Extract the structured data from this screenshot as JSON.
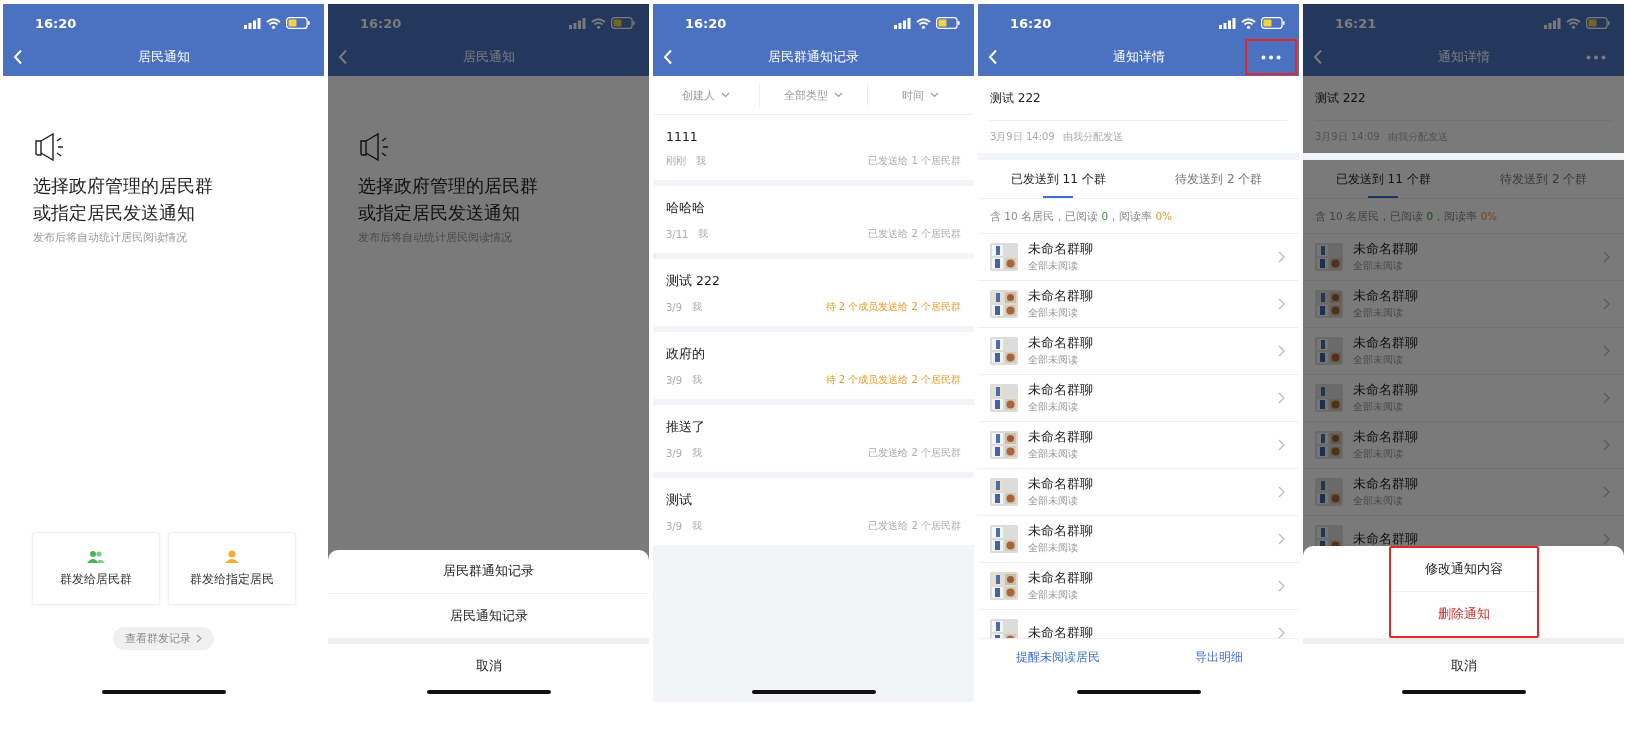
{
  "screens": [
    {
      "kind": "home",
      "dimmed": false,
      "time": "16:20",
      "title": "居民通知",
      "headline": "选择政府管理的居民群或指定居民发送通知",
      "subtitle": "发布后将自动统计居民阅读情况",
      "actions": [
        {
          "label": "群发给居民群",
          "kind": "group"
        },
        {
          "label": "群发给指定居民",
          "kind": "person"
        }
      ],
      "record_link": "查看群发记录"
    },
    {
      "kind": "home",
      "dimmed": true,
      "time": "16:20",
      "title": "居民通知",
      "headline": "选择政府管理的居民群或指定居民发送通知",
      "subtitle": "发布后将自动统计居民阅读情况",
      "sheet": {
        "highlighted": false,
        "options": [
          {
            "label": "居民群通知记录",
            "danger": false
          },
          {
            "label": "居民通知记录",
            "danger": false
          }
        ],
        "cancel": "取消"
      }
    },
    {
      "kind": "records",
      "dimmed": false,
      "time": "16:20",
      "title": "居民群通知记录",
      "filters": [
        "创建人",
        "全部类型",
        "时间"
      ],
      "records": [
        {
          "title": "1111",
          "date": "刚刚",
          "author": "我",
          "status": "已发送给 1 个居民群",
          "pending": false
        },
        {
          "title": "哈哈哈",
          "date": "3/11",
          "author": "我",
          "status": "已发送给 2 个居民群",
          "pending": false
        },
        {
          "title": "测试 222",
          "date": "3/9",
          "author": "我",
          "status": "待 2 个成员发送给 2 个居民群",
          "pending": true
        },
        {
          "title": "政府的",
          "date": "3/9",
          "author": "我",
          "status": "待 2 个成员发送给 2 个居民群",
          "pending": true
        },
        {
          "title": "推送了",
          "date": "3/9",
          "author": "我",
          "status": "已发送给 2 个居民群",
          "pending": false
        },
        {
          "title": "测试",
          "date": "3/9",
          "author": "我",
          "status": "已发送给 2 个居民群",
          "pending": false
        }
      ]
    },
    {
      "kind": "detail",
      "dimmed": false,
      "time": "16:20",
      "title": "通知详情",
      "more_highlighted": true,
      "notice": {
        "title": "测试 222",
        "date": "3月9日 14:09",
        "note": "由我分配发送"
      },
      "tabs": [
        {
          "label": "已发送到 11 个群",
          "selected": true
        },
        {
          "label": "待发送到 2 个群",
          "selected": false
        }
      ],
      "summary": [
        {
          "text": "含 10 名居民，已阅读 ",
          "kind": "plain"
        },
        {
          "text": "0",
          "kind": "read"
        },
        {
          "text": "，阅读率 ",
          "kind": "plain"
        },
        {
          "text": "0%",
          "kind": "rate"
        }
      ],
      "groups": [
        {
          "name": "未命名群聊",
          "status": "全部未阅读"
        },
        {
          "name": "未命名群聊",
          "status": "全部未阅读"
        },
        {
          "name": "未命名群聊",
          "status": "全部未阅读"
        },
        {
          "name": "未命名群聊",
          "status": "全部未阅读"
        },
        {
          "name": "未命名群聊",
          "status": "全部未阅读"
        },
        {
          "name": "未命名群聊",
          "status": "全部未阅读"
        },
        {
          "name": "未命名群聊",
          "status": "全部未阅读"
        },
        {
          "name": "未命名群聊",
          "status": "全部未阅读"
        },
        {
          "name": "未命名群聊"
        }
      ],
      "footer": [
        "提醒未阅读居民",
        "导出明细"
      ]
    },
    {
      "kind": "detail",
      "dimmed": true,
      "time": "16:21",
      "title": "通知详情",
      "more_highlighted": false,
      "notice": {
        "title": "测试 222",
        "date": "3月9日 14:09",
        "note": "由我分配发送"
      },
      "tabs": [
        {
          "label": "已发送到 11 个群",
          "selected": true
        },
        {
          "label": "待发送到 2 个群",
          "selected": false
        }
      ],
      "summary": [
        {
          "text": "含 10 名居民，已阅读 ",
          "kind": "plain"
        },
        {
          "text": "0",
          "kind": "read"
        },
        {
          "text": "，阅读率 ",
          "kind": "plain"
        },
        {
          "text": "0%",
          "kind": "rate"
        }
      ],
      "groups": [
        {
          "name": "未命名群聊",
          "status": "全部未阅读"
        },
        {
          "name": "未命名群聊",
          "status": "全部未阅读"
        },
        {
          "name": "未命名群聊",
          "status": "全部未阅读"
        },
        {
          "name": "未命名群聊",
          "status": "全部未阅读"
        },
        {
          "name": "未命名群聊",
          "status": "全部未阅读"
        },
        {
          "name": "未命名群聊",
          "status": "全部未阅读"
        },
        {
          "name": "未命名群聊"
        }
      ],
      "sheet": {
        "highlighted": true,
        "options": [
          {
            "label": "修改通知内容",
            "danger": false
          },
          {
            "label": "删除通知",
            "danger": true
          }
        ],
        "cancel": "取消"
      }
    }
  ]
}
